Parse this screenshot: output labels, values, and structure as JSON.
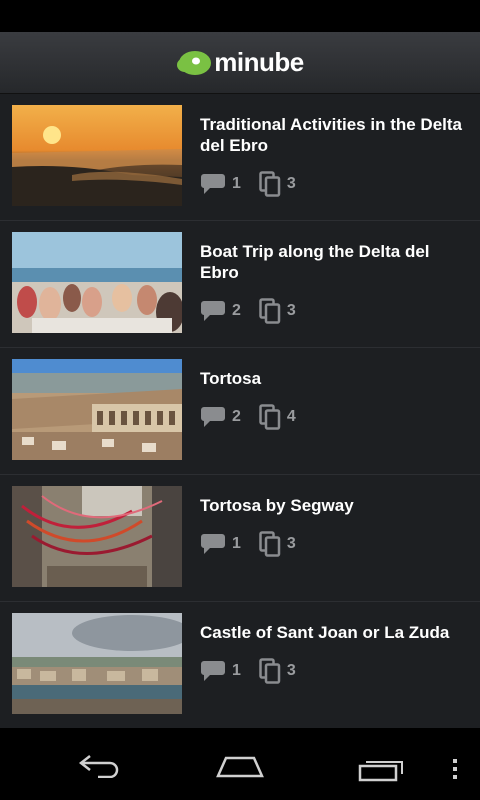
{
  "app": {
    "logo_text": "minube",
    "brand_color": "#7ac143"
  },
  "items": [
    {
      "title": "Traditional Activities in the Delta del Ebro",
      "comments": "1",
      "photos": "3"
    },
    {
      "title": "Boat Trip along the Delta del Ebro",
      "comments": "2",
      "photos": "3"
    },
    {
      "title": "Tortosa",
      "comments": "2",
      "photos": "4"
    },
    {
      "title": "Tortosa by Segway",
      "comments": "1",
      "photos": "3"
    },
    {
      "title": "Castle of Sant Joan or La Zuda",
      "comments": "1",
      "photos": "3"
    }
  ],
  "icons": {
    "comment": "comment-bubble-icon",
    "photos": "photo-stack-icon",
    "back": "back-icon",
    "home": "home-icon",
    "recents": "recent-apps-icon",
    "menu": "overflow-menu-icon"
  }
}
